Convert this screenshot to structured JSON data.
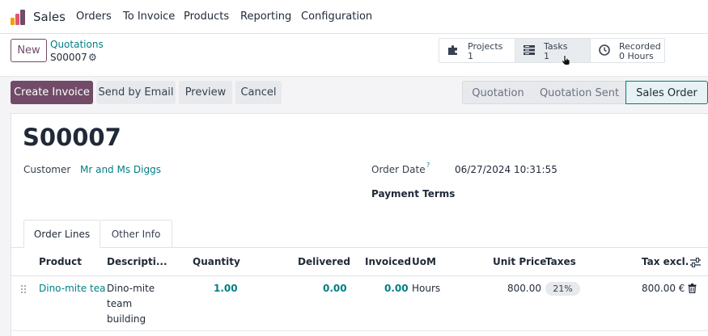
{
  "navbar": {
    "app_name": "Sales",
    "menu": [
      "Orders",
      "To Invoice",
      "Products",
      "Reporting",
      "Configuration"
    ]
  },
  "control_panel": {
    "new_label": "New",
    "breadcrumb_parent": "Quotations",
    "breadcrumb_current": "S00007",
    "smart_buttons": [
      {
        "label": "Projects",
        "value": "1",
        "icon": "puzzle-icon"
      },
      {
        "label": "Tasks",
        "value": "1",
        "icon": "tasks-icon"
      },
      {
        "label": "Recorded",
        "value": "0 Hours",
        "icon": "clock-icon"
      }
    ]
  },
  "actions": {
    "create_invoice": "Create Invoice",
    "send_email": "Send by Email",
    "preview": "Preview",
    "cancel": "Cancel"
  },
  "status": {
    "stages": [
      "Quotation",
      "Quotation Sent",
      "Sales Order"
    ],
    "active": "Sales Order"
  },
  "form": {
    "title": "S00007",
    "customer_label": "Customer",
    "customer_value": "Mr and Ms Diggs",
    "order_date_label": "Order Date",
    "order_date_help": "?",
    "order_date_value": "06/27/2024 10:31:55",
    "payment_terms_label": "Payment Terms"
  },
  "tabs": [
    "Order Lines",
    "Other Info"
  ],
  "order_lines": {
    "columns": [
      "Product",
      "Descripti...",
      "Quantity",
      "Delivered",
      "Invoiced",
      "UoM",
      "Unit Price",
      "Taxes",
      "Tax excl."
    ],
    "rows": [
      {
        "product": "Dino-mite team",
        "description_lines": [
          "Dino-mite",
          "team",
          "building"
        ],
        "quantity": "1.00",
        "delivered": "0.00",
        "invoiced": "0.00",
        "uom": "Hours",
        "unit_price": "800.00",
        "taxes": "21%",
        "tax_excl": "800.00 €"
      }
    ]
  },
  "colors": {
    "brand": "#714b67",
    "link": "#017e84"
  }
}
